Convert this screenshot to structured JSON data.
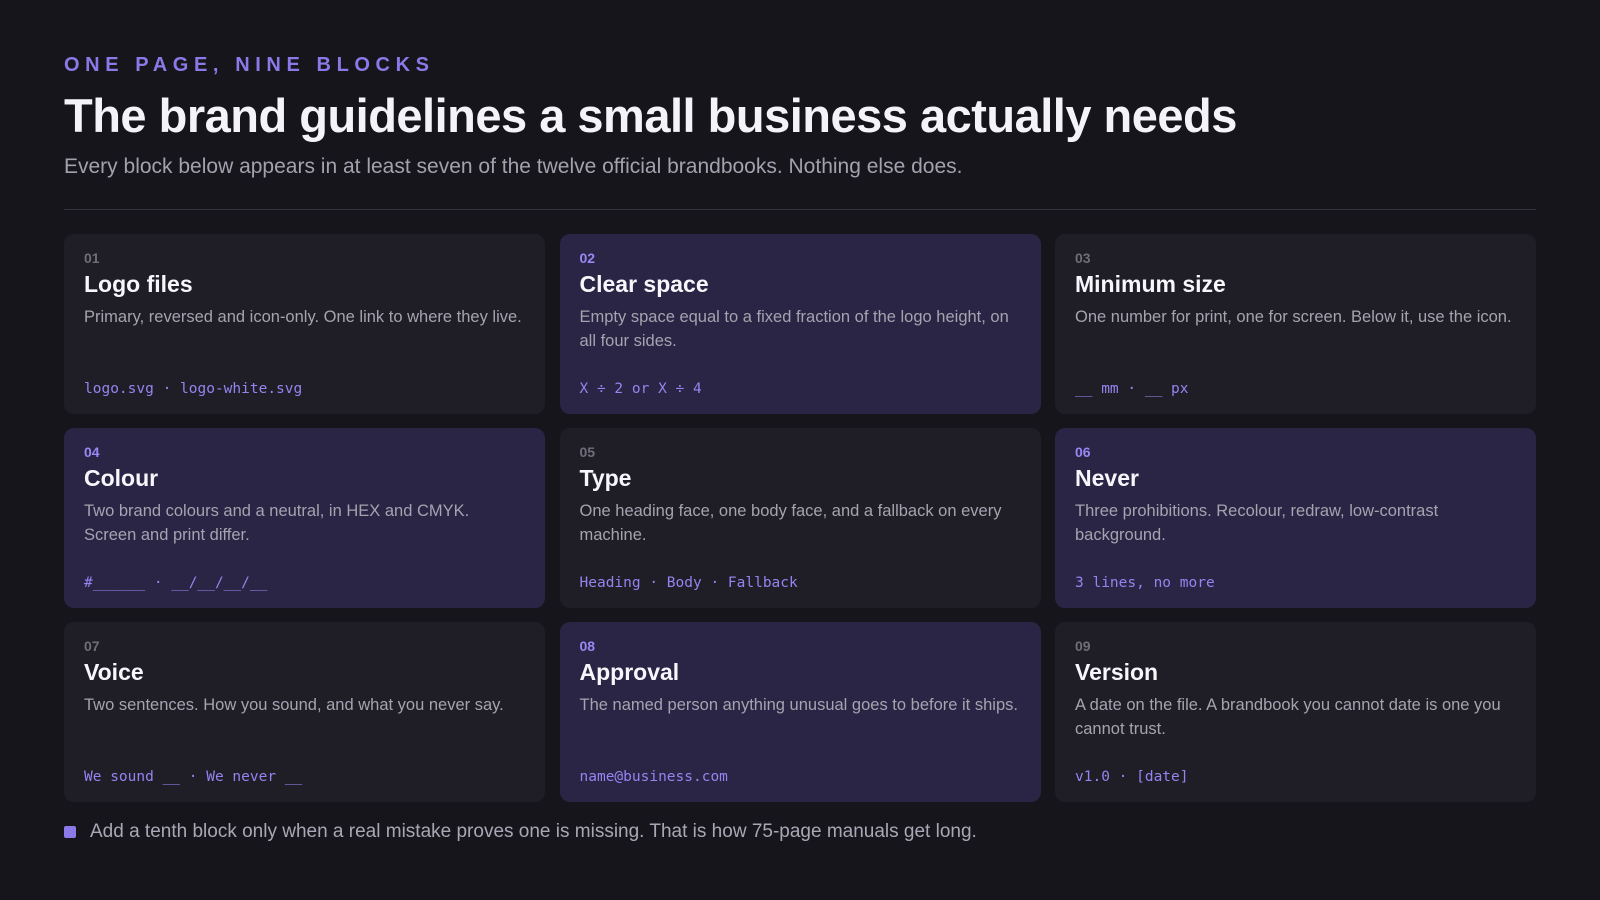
{
  "header": {
    "eyebrow": "ONE PAGE, NINE BLOCKS",
    "title": "The brand guidelines a small business actually needs",
    "subtitle": "Every block below appears in at least seven of the twelve official brandbooks. Nothing else does."
  },
  "colors": {
    "background": "#16151c",
    "card": "#1f1e27",
    "card_accent": "#2a2544",
    "accent": "#8b79e8"
  },
  "blocks": [
    {
      "num": "01",
      "title": "Logo files",
      "desc": "Primary, reversed and icon-only. One link to where they live.",
      "code": "logo.svg · logo-white.svg",
      "accent": false
    },
    {
      "num": "02",
      "title": "Clear space",
      "desc": "Empty space equal to a fixed fraction of the logo height, on all four sides.",
      "code": "X ÷ 2 or X ÷ 4",
      "accent": true
    },
    {
      "num": "03",
      "title": "Minimum size",
      "desc": "One number for print, one for screen. Below it, use the icon.",
      "code": "__ mm · __ px",
      "accent": false
    },
    {
      "num": "04",
      "title": "Colour",
      "desc": "Two brand colours and a neutral, in HEX and CMYK. Screen and print differ.",
      "code": "#______ · __/__/__/__",
      "accent": true
    },
    {
      "num": "05",
      "title": "Type",
      "desc": "One heading face, one body face, and a fallback on every machine.",
      "code": "Heading · Body · Fallback",
      "accent": false
    },
    {
      "num": "06",
      "title": "Never",
      "desc": "Three prohibitions. Recolour, redraw, low-contrast background.",
      "code": "3 lines, no more",
      "accent": true
    },
    {
      "num": "07",
      "title": "Voice",
      "desc": "Two sentences. How you sound, and what you never say.",
      "code": "We sound __ · We never __",
      "accent": false
    },
    {
      "num": "08",
      "title": "Approval",
      "desc": "The named person anything unusual goes to before it ships.",
      "code": "name@business.com",
      "accent": true
    },
    {
      "num": "09",
      "title": "Version",
      "desc": "A date on the file. A brandbook you cannot date is one you cannot trust.",
      "code": "v1.0 · [date]",
      "accent": false
    }
  ],
  "footnote": {
    "text": "Add a tenth block only when a real mistake proves one is missing. That is how 75-page manuals get long."
  }
}
